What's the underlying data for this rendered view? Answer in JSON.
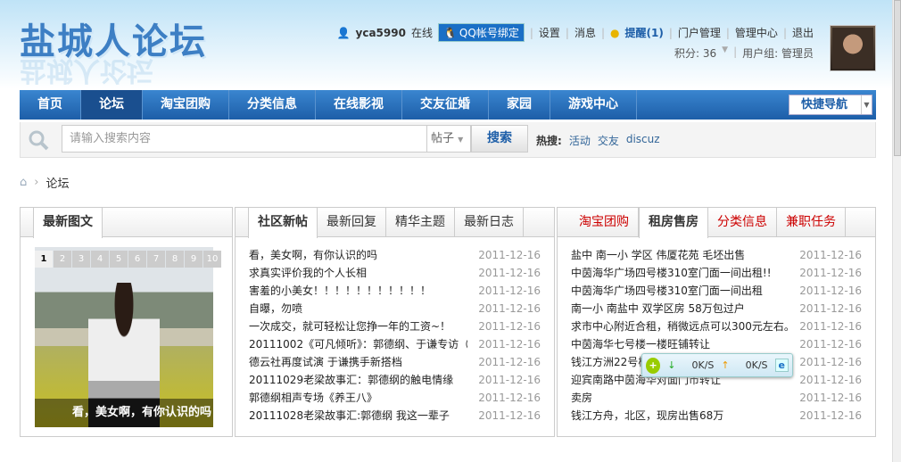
{
  "header": {
    "logo": "盐城人论坛",
    "username": "yca5990",
    "online": "在线",
    "qq_bind": "QQ帐号绑定",
    "links": [
      "设置",
      "消息"
    ],
    "remind": "提醒(1)",
    "links2": [
      "门户管理",
      "管理中心",
      "退出"
    ],
    "points": "积分: 36",
    "usergroup": "用户组: 管理员"
  },
  "nav": {
    "items": [
      "首页",
      "论坛",
      "淘宝团购",
      "分类信息",
      "在线影视",
      "交友征婚",
      "家园",
      "游戏中心"
    ],
    "active": 1,
    "quick": "快捷导航"
  },
  "search": {
    "placeholder": "请输入搜索内容",
    "type": "帖子",
    "button": "搜索",
    "hot_label": "热搜:",
    "hot": [
      "活动",
      "交友",
      "discuz"
    ]
  },
  "breadcrumb": {
    "current": "论坛"
  },
  "left_panel": {
    "tab": "最新图文",
    "thumbs": [
      "1",
      "2",
      "3",
      "4",
      "5",
      "6",
      "7",
      "8",
      "9",
      "10"
    ],
    "caption": "看，美女啊，有你认识的吗"
  },
  "mid_panel": {
    "tabs": [
      "社区新帖",
      "最新回复",
      "精华主题",
      "最新日志"
    ],
    "rows": [
      {
        "t": "看，美女啊，有你认识的吗",
        "d": "2011-12-16"
      },
      {
        "t": "求真实评价我的个人长相",
        "d": "2011-12-16"
      },
      {
        "t": "害羞的小美女！！！！！！！！！！！",
        "d": "2011-12-16"
      },
      {
        "t": "自曝，勿喷",
        "d": "2011-12-16"
      },
      {
        "t": "一次成交，就可轻松让您挣一年的工资~！",
        "d": "2011-12-16"
      },
      {
        "t": "20111002《可凡倾听》：郭德纲、于谦专访（",
        "d": "2011-12-16"
      },
      {
        "t": "德云社再度试演 于谦携手新搭档",
        "d": "2011-12-16"
      },
      {
        "t": "20111029老梁故事汇：郭德纲的触电情缘",
        "d": "2011-12-16"
      },
      {
        "t": "郭德纲相声专场《养王八》",
        "d": "2011-12-16"
      },
      {
        "t": "20111028老梁故事汇:郭德纲 我这一辈子",
        "d": "2011-12-16"
      }
    ]
  },
  "right_panel": {
    "tabs": [
      "淘宝团购",
      "租房售房",
      "分类信息",
      "兼职任务"
    ],
    "rows": [
      {
        "t": "盐中 南一小 学区 伟厦花苑 毛坯出售",
        "d": "2011-12-16"
      },
      {
        "t": "中茵海华广场四号楼310室门面一间出租!!",
        "d": "2011-12-16"
      },
      {
        "t": "中茵海华广场四号楼310室门面一间出租",
        "d": "2011-12-16"
      },
      {
        "t": "南一小 南盐中 双学区房 58万包过户",
        "d": "2011-12-16"
      },
      {
        "t": "求市中心附近合租，稍微远点可以300元左右。",
        "d": "2011-12-16"
      },
      {
        "t": "中茵海华七号楼一楼旺铺转让",
        "d": "2011-12-16"
      },
      {
        "t": "钱江方洲22号楼",
        "d": "2011-12-16"
      },
      {
        "t": "迎宾南路中茵海华对面门市转让",
        "d": "2011-12-16"
      },
      {
        "t": "卖房",
        "d": "2011-12-16"
      },
      {
        "t": "钱江方舟，北区，现房出售68万",
        "d": "2011-12-16"
      }
    ]
  },
  "speed_widget": {
    "down": "0K/S",
    "up": "0K/S"
  }
}
